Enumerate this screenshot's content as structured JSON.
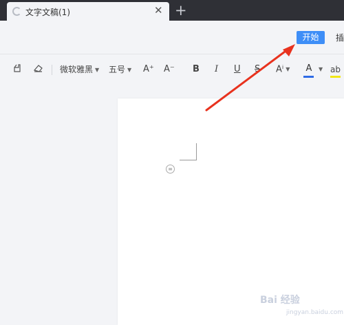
{
  "tabbar": {
    "tab_title": "文字文稿(1)",
    "close_glyph": "✕",
    "new_tab_glyph": "+"
  },
  "menubar": {
    "start_label": "开始",
    "insert_label_partial": "插"
  },
  "toolbar": {
    "font_name": "微软雅黑",
    "font_size": "五号",
    "grow_glyph": "A⁺",
    "shrink_glyph": "A⁻",
    "bold": "B",
    "italic": "I",
    "underline": "U",
    "strike": "S",
    "superscript": "Aⁱ",
    "font_color": "A",
    "highlight": "ab",
    "caret": "▼",
    "accent_blue": "#2e6be6",
    "highlight_yellow": "#f1e716"
  },
  "watermark": {
    "text": "Bai 经验",
    "sub": "jingyan.baidu.com"
  },
  "annotation": {
    "arrow_color": "#e8321e"
  }
}
